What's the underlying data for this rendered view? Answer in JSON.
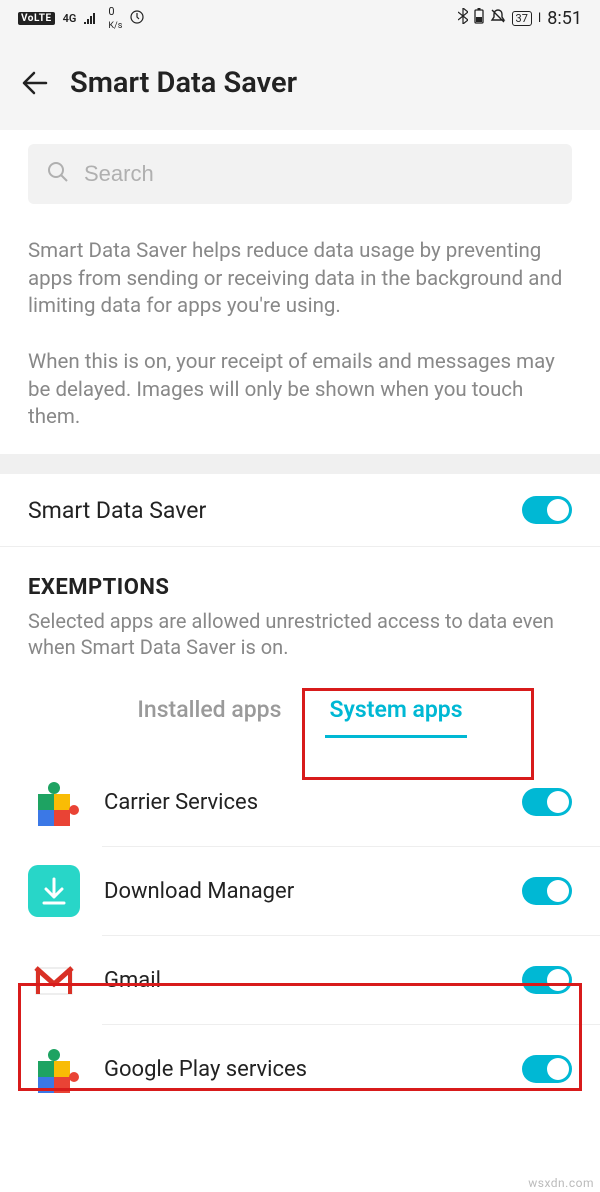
{
  "status": {
    "volte": "VoLTE",
    "network": "4G",
    "speed_top": "0",
    "speed_unit": "K/s",
    "battery": "37",
    "time": "8:51"
  },
  "header": {
    "title": "Smart Data Saver"
  },
  "search": {
    "placeholder": "Search"
  },
  "description": {
    "p1": "Smart Data Saver helps reduce data usage by preventing apps from sending or receiving data in the background and limiting data for apps you're using.",
    "p2": "When this is on, your receipt of emails and messages may be delayed. Images will only be shown when you touch them."
  },
  "main_toggle": {
    "label": "Smart Data Saver"
  },
  "exemptions": {
    "heading": "EXEMPTIONS",
    "subtext": "Selected apps are allowed unrestricted access to data even when Smart Data Saver is on."
  },
  "tabs": {
    "installed": "Installed apps",
    "system": "System apps"
  },
  "apps": [
    {
      "name": "Carrier Services"
    },
    {
      "name": "Download Manager"
    },
    {
      "name": "Gmail"
    },
    {
      "name": "Google Play services"
    }
  ],
  "watermark": "wsxdn.com"
}
